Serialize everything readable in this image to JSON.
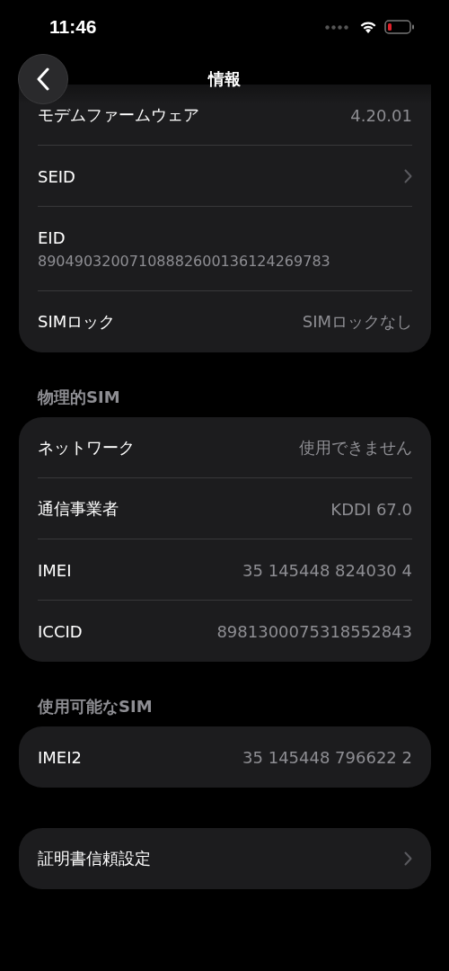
{
  "status_bar": {
    "time": "11:46"
  },
  "nav": {
    "title": "情報"
  },
  "sections": [
    {
      "rows": [
        {
          "kind": "value",
          "label": "モデムファームウェア",
          "value": "4.20.01"
        },
        {
          "kind": "chevron",
          "label": "SEID"
        },
        {
          "kind": "stacked",
          "label": "EID",
          "value": "89049032007108882600136124269783"
        },
        {
          "kind": "value",
          "label": "SIMロック",
          "value": "SIMロックなし"
        }
      ]
    },
    {
      "header": "物理的SIM",
      "rows": [
        {
          "kind": "value",
          "label": "ネットワーク",
          "value": "使用できません"
        },
        {
          "kind": "value",
          "label": "通信事業者",
          "value": "KDDI 67.0"
        },
        {
          "kind": "value",
          "label": "IMEI",
          "value": "35 145448 824030 4"
        },
        {
          "kind": "value",
          "label": "ICCID",
          "value": "8981300075318552843"
        }
      ]
    },
    {
      "header": "使用可能なSIM",
      "rows": [
        {
          "kind": "value",
          "label": "IMEI2",
          "value": "35 145448 796622 2"
        }
      ]
    },
    {
      "rows": [
        {
          "kind": "chevron",
          "label": "証明書信頼設定"
        }
      ]
    }
  ]
}
